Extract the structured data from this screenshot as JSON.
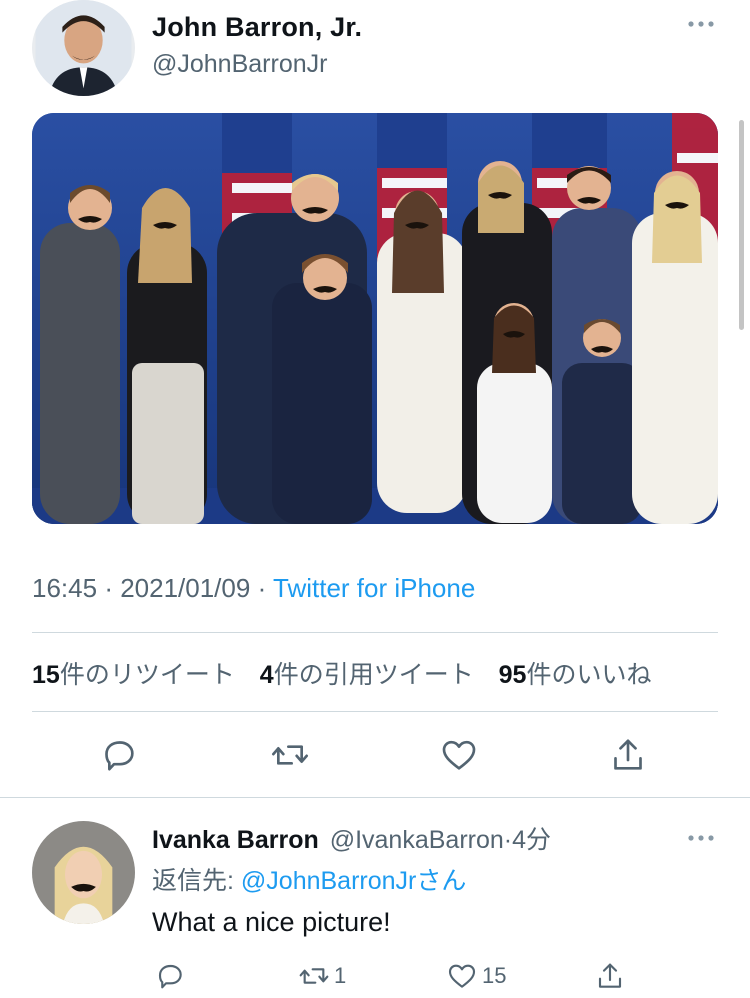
{
  "tweet": {
    "author_name": "John Barron, Jr.",
    "author_handle": "@JohnBarronJr",
    "time": "16:45",
    "date": "2021/01/09",
    "separator": "·",
    "client": "Twitter for iPhone"
  },
  "stats": {
    "retweets_count": "15",
    "retweets_label": "件のリツイート",
    "quotes_count": "4",
    "quotes_label": "件の引用ツイート",
    "likes_count": "95",
    "likes_label": "件のいいね"
  },
  "reply": {
    "author_name": "Ivanka Barron",
    "author_handle": "@IvankaBarron",
    "separator": "·",
    "time_ago": "4分",
    "reply_to_prefix": "返信先: ",
    "reply_to_mention": "@JohnBarronJr",
    "reply_to_suffix": "さん",
    "text": "What a nice picture!",
    "retweet_count": "1",
    "like_count": "15"
  },
  "icons": {
    "reply": "reply-icon",
    "retweet": "retweet-icon",
    "like": "heart-icon",
    "share": "share-icon",
    "more": "more-icon"
  },
  "colors": {
    "link": "#1d9bf0",
    "secondary_text": "#536471",
    "primary_text": "#0f1419",
    "divider": "#cfd9de"
  }
}
